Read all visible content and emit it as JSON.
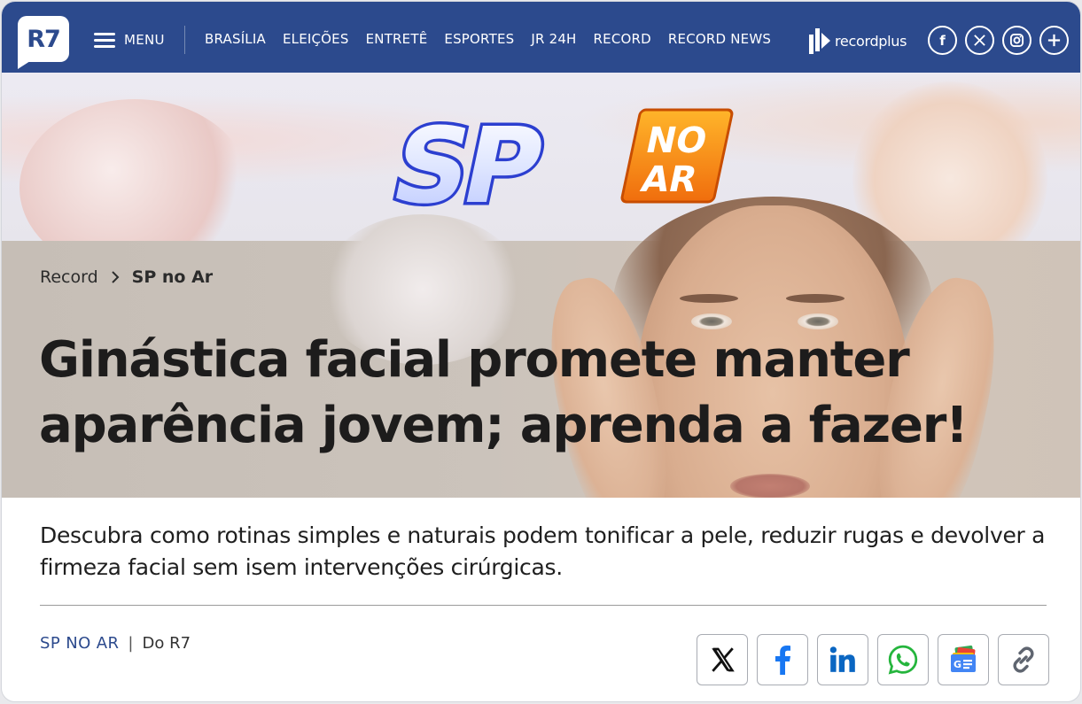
{
  "header": {
    "logo_text": "R7",
    "menu_label": "MENU",
    "nav_links": [
      "BRASÍLIA",
      "ELEIÇÕES",
      "ENTRETÊ",
      "ESPORTES",
      "JR 24H",
      "RECORD",
      "RECORD NEWS"
    ],
    "recordplus_label": "recordplus",
    "social_icons": [
      "facebook-icon",
      "x-icon",
      "instagram-icon",
      "plus-icon"
    ],
    "colors": {
      "bar": "#2c4a8d",
      "text": "#ffffff"
    }
  },
  "banner": {
    "show_logo_text_sp": "SP",
    "show_logo_text_no": "NO",
    "show_logo_text_ar": "AR"
  },
  "breadcrumb": {
    "parent": "Record",
    "current": "SP no Ar"
  },
  "article": {
    "headline": "Ginástica facial promete manter aparência jovem; aprenda a fazer!",
    "subtitle": "Descubra como rotinas simples e naturais podem tonificar a pele, reduzir rugas e devolver a firmeza facial sem isem intervenções cirúrgicas.",
    "section_label": "SP NO AR",
    "source": "Do R7"
  },
  "share_buttons": [
    "x-icon",
    "facebook-icon",
    "linkedin-icon",
    "whatsapp-icon",
    "google-news-icon",
    "link-icon"
  ]
}
